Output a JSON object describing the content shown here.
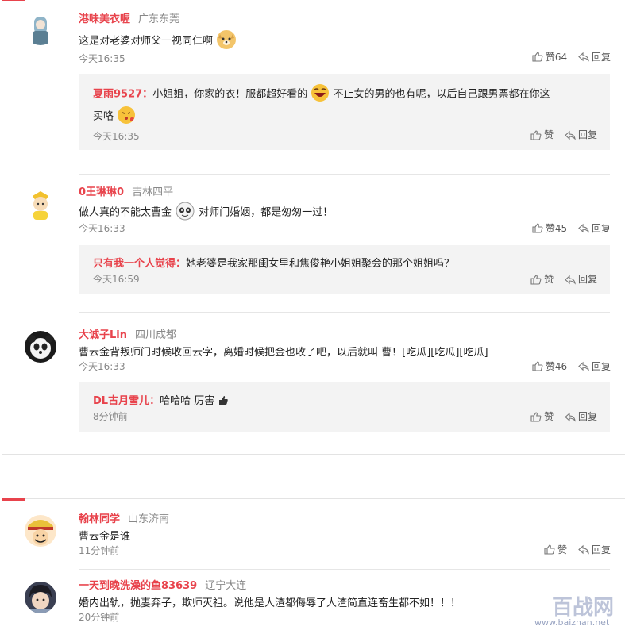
{
  "comments": [
    {
      "user": "港味美衣喔",
      "location": "广东东莞",
      "text": "这是对老婆对师父一视同仁啊",
      "time": "今天16:35",
      "likes": "赞64",
      "reply_label": "回复",
      "replies": [
        {
          "user": "夏雨9527：",
          "text_a": "小姐姐，你家的衣！服都超好看的",
          "text_b": "不止女的男的也有呢，以后自己跟男票都在你这",
          "text_c": "买咯",
          "time": "今天16:35",
          "likes": "赞",
          "reply_label": "回复"
        }
      ]
    },
    {
      "user": "0王琳琳0",
      "location": "吉林四平",
      "text_a": "做人真的不能太曹金",
      "text_b": "对师门婚姻，都是匆匆一过！",
      "time": "今天16:33",
      "likes": "赞45",
      "reply_label": "回复",
      "replies": [
        {
          "user": "只有我一个人觉得：",
          "text": "她老婆是我家那闺女里和焦俊艳小姐姐聚会的那个姐姐吗？",
          "time": "今天16:59",
          "likes": "赞",
          "reply_label": "回复"
        }
      ]
    },
    {
      "user": "大诚子Lin",
      "location": "四川成都",
      "text": "曹云金背叛师门时候收回云字，离婚时候把金也收了吧，以后就叫 曹！[吃瓜][吃瓜][吃瓜]",
      "time": "今天16:33",
      "likes": "赞46",
      "reply_label": "回复",
      "replies": [
        {
          "user": "DL古月雪儿：",
          "text": "哈哈哈 厉害",
          "time": "8分钟前",
          "likes": "赞",
          "reply_label": "回复"
        }
      ]
    },
    {
      "user": "翰林同学",
      "location": "山东济南",
      "text": "曹云金是谁",
      "time": "11分钟前",
      "likes": "赞",
      "reply_label": "回复"
    },
    {
      "user": "一天到晚洗澡的鱼83639",
      "location": "辽宁大连",
      "text": "婚内出轨，抛妻弃子，欺师灭祖。说他是人渣都侮辱了人渣简直连畜生都不如！！！",
      "time": "20分钟前"
    }
  ],
  "watermark": {
    "text": "百战网",
    "url": "www.baizhan.net"
  },
  "colors": {
    "accent": "#e8434c",
    "reply_bg": "#f3f3f3"
  }
}
